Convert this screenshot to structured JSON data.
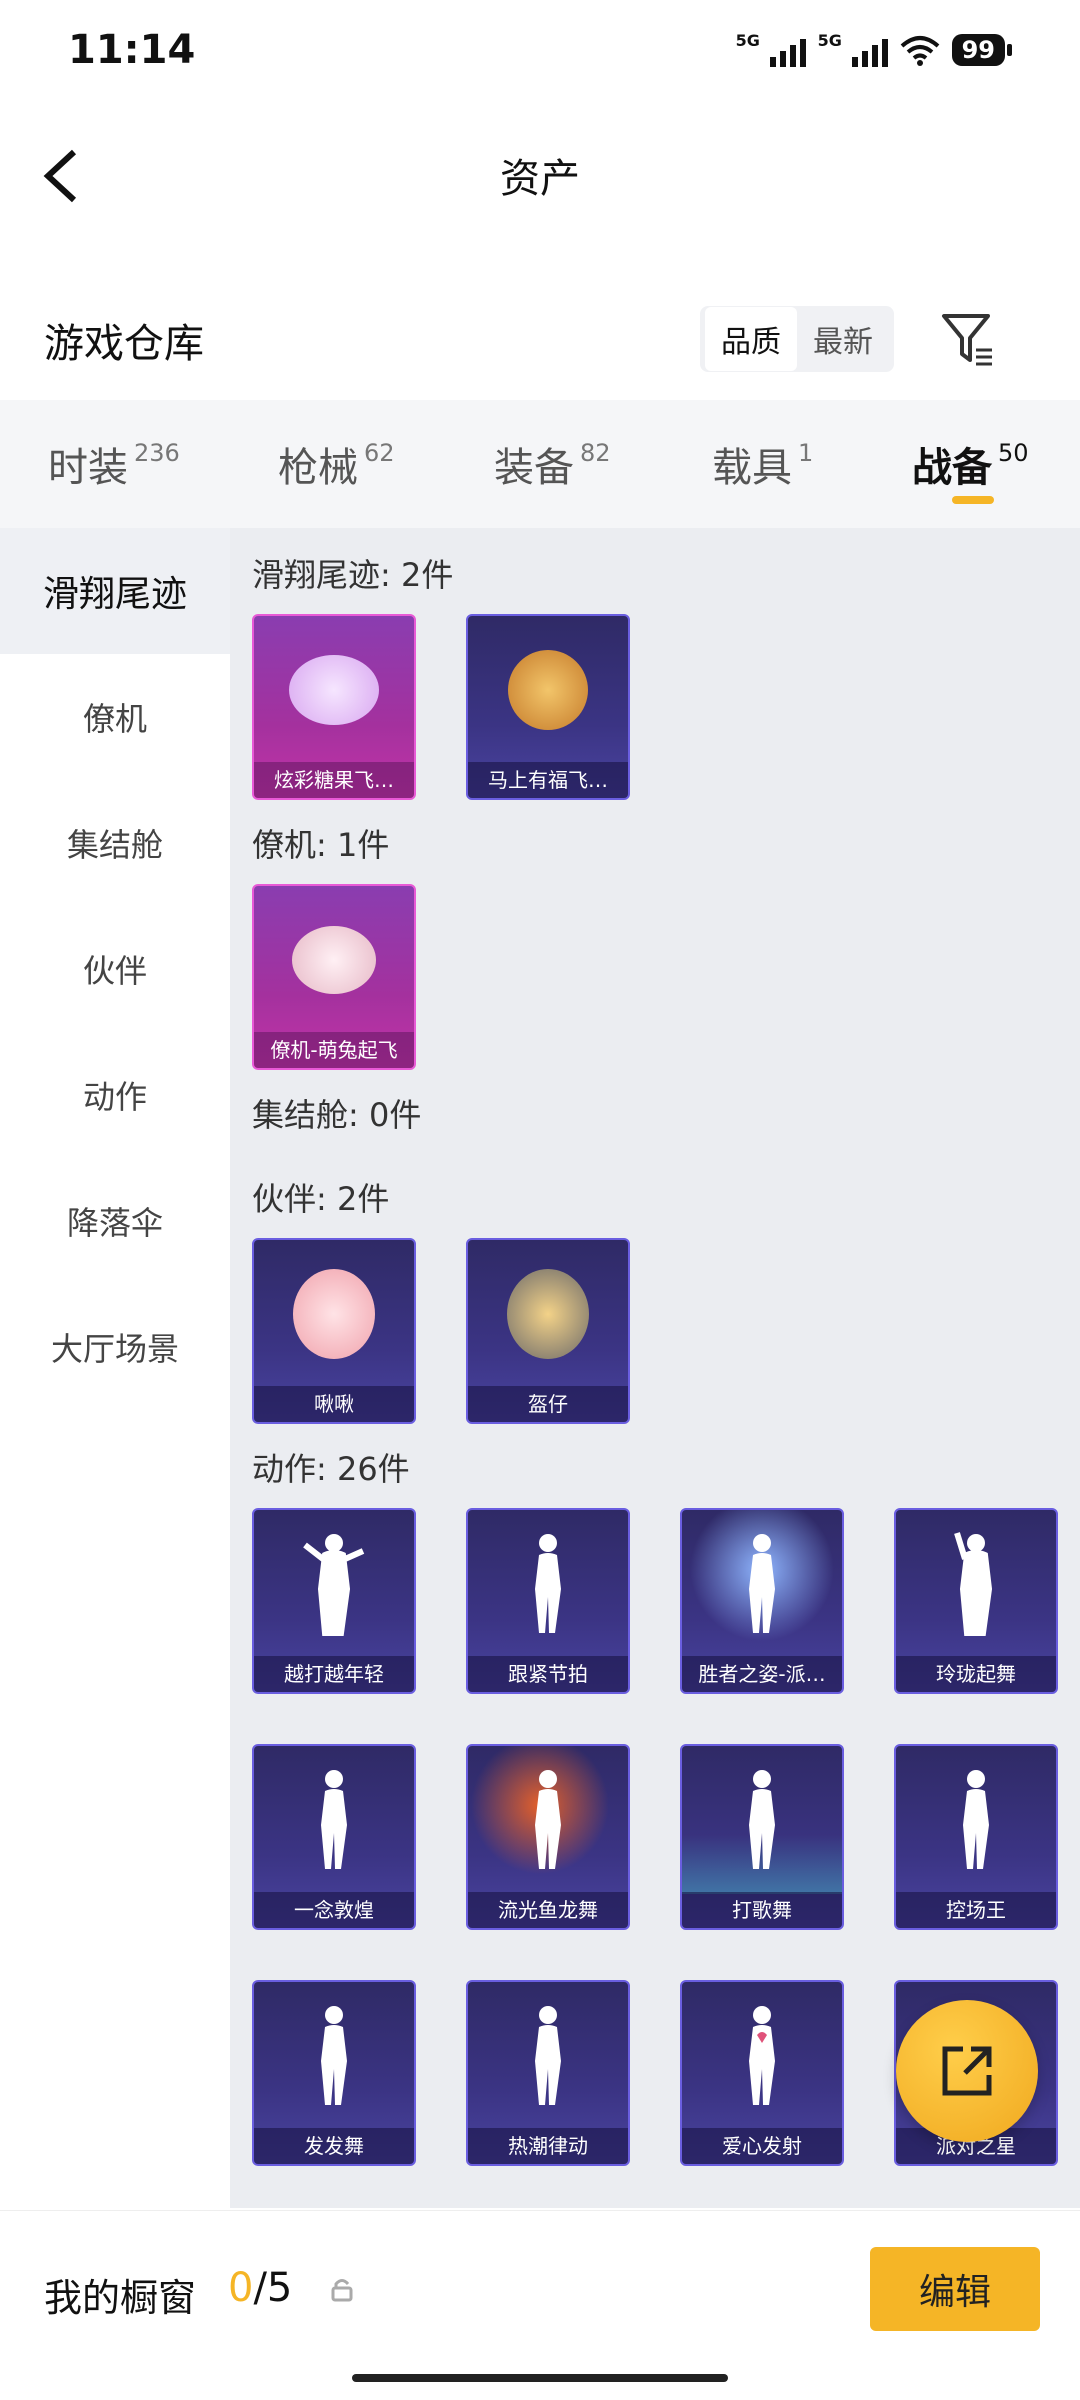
{
  "status": {
    "time": "11:14",
    "sim1": "5G",
    "sim2": "5G",
    "battery": "99"
  },
  "nav": {
    "title": "资产"
  },
  "section": {
    "title": "游戏仓库",
    "sort_quality": "品质",
    "sort_newest": "最新"
  },
  "tabs": [
    {
      "label": "时装",
      "count": "236"
    },
    {
      "label": "枪械",
      "count": "62"
    },
    {
      "label": "装备",
      "count": "82"
    },
    {
      "label": "载具",
      "count": "1"
    },
    {
      "label": "战备",
      "count": "50"
    }
  ],
  "sidebar": {
    "items": [
      {
        "label": "滑翔尾迹"
      },
      {
        "label": "僚机"
      },
      {
        "label": "集结舱"
      },
      {
        "label": "伙伴"
      },
      {
        "label": "动作"
      },
      {
        "label": "降落伞"
      },
      {
        "label": "大厅场景"
      }
    ]
  },
  "content": {
    "glide": {
      "header": "滑翔尾迹: 2件",
      "items": [
        {
          "name": "炫彩糖果飞…"
        },
        {
          "name": "马上有福飞…"
        }
      ]
    },
    "wingman": {
      "header": "僚机: 1件",
      "items": [
        {
          "name": "僚机-萌兔起飞"
        }
      ]
    },
    "capsule": {
      "header": "集结舱: 0件"
    },
    "partner": {
      "header": "伙伴: 2件",
      "items": [
        {
          "name": "啾啾"
        },
        {
          "name": "盔仔"
        }
      ]
    },
    "emote": {
      "header": "动作: 26件",
      "items": [
        {
          "name": "越打越年轻"
        },
        {
          "name": "跟紧节拍"
        },
        {
          "name": "胜者之姿-派…"
        },
        {
          "name": "玲珑起舞"
        },
        {
          "name": "一念敦煌"
        },
        {
          "name": "流光鱼龙舞"
        },
        {
          "name": "打歌舞"
        },
        {
          "name": "控场王"
        },
        {
          "name": "发发舞"
        },
        {
          "name": "热潮律动"
        },
        {
          "name": "爱心发射"
        },
        {
          "name": "派对之星"
        }
      ]
    }
  },
  "footer": {
    "window_label": "我的橱窗",
    "current": "0",
    "total": "/5",
    "edit_label": "编辑"
  },
  "colors": {
    "accent": "#f5b526",
    "card_purple": "#3b3484",
    "card_pink": "#a4319e"
  }
}
